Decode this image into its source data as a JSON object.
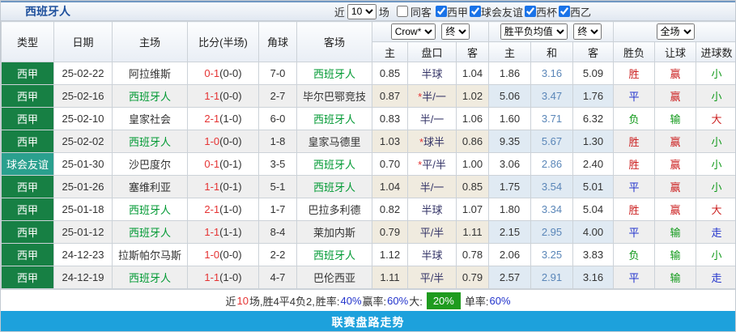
{
  "title": "西班牙人",
  "toolbar": {
    "recent_label": "近",
    "recent_value": "10",
    "games_label": "场",
    "same_away_label": "同客",
    "same_away_checked": false,
    "league_filters": [
      {
        "label": "西甲",
        "checked": true
      },
      {
        "label": "球会友谊",
        "checked": true
      },
      {
        "label": "西杯",
        "checked": true
      },
      {
        "label": "西乙",
        "checked": true
      }
    ]
  },
  "header": {
    "static_cols": [
      "类型",
      "日期",
      "主场",
      "比分(半场)",
      "角球",
      "客场"
    ],
    "groups": [
      {
        "select": "Crow*",
        "extra_select": "终",
        "cols": [
          "主",
          "盘口",
          "客"
        ]
      },
      {
        "select": "胜平负均值",
        "extra_select": "终",
        "cols": [
          "主",
          "和",
          "客"
        ]
      },
      {
        "select": "全场",
        "extra_select": "",
        "cols": [
          "胜负",
          "让球",
          "进球数"
        ]
      }
    ]
  },
  "rows": [
    {
      "type": "西甲",
      "type_class": "league",
      "date": "25-02-22",
      "home": "阿拉维斯",
      "home_self": false,
      "score": "0-1",
      "half": "(0-0)",
      "corner": "7-0",
      "away": "西班牙人",
      "away_self": true,
      "odds_home": "0.85",
      "handicap": "半球",
      "handicap_star": false,
      "odds_away": "1.04",
      "avg_home": "1.86",
      "avg_draw": "3.16",
      "avg_away": "5.09",
      "result": "胜",
      "result_class": "red",
      "handicap_result": "赢",
      "handicap_class": "red",
      "goals": "小",
      "goals_class": "green"
    },
    {
      "type": "西甲",
      "type_class": "league",
      "date": "25-02-16",
      "home": "西班牙人",
      "home_self": true,
      "score": "1-1",
      "half": "(0-0)",
      "corner": "2-7",
      "away": "毕尔巴鄂竞技",
      "away_self": false,
      "odds_home": "0.87",
      "handicap": "半/一",
      "handicap_star": true,
      "odds_away": "1.02",
      "avg_home": "5.06",
      "avg_draw": "3.47",
      "avg_away": "1.76",
      "result": "平",
      "result_class": "blue",
      "handicap_result": "赢",
      "handicap_class": "red",
      "goals": "小",
      "goals_class": "green"
    },
    {
      "type": "西甲",
      "type_class": "league",
      "date": "25-02-10",
      "home": "皇家社会",
      "home_self": false,
      "score": "2-1",
      "half": "(1-0)",
      "corner": "6-0",
      "away": "西班牙人",
      "away_self": true,
      "odds_home": "0.83",
      "handicap": "半/一",
      "handicap_star": false,
      "odds_away": "1.06",
      "avg_home": "1.60",
      "avg_draw": "3.71",
      "avg_away": "6.32",
      "result": "负",
      "result_class": "green",
      "handicap_result": "输",
      "handicap_class": "green",
      "goals": "大",
      "goals_class": "red"
    },
    {
      "type": "西甲",
      "type_class": "league",
      "date": "25-02-02",
      "home": "西班牙人",
      "home_self": true,
      "score": "1-0",
      "half": "(0-0)",
      "corner": "1-8",
      "away": "皇家马德里",
      "away_self": false,
      "odds_home": "1.03",
      "handicap": "球半",
      "handicap_star": true,
      "odds_away": "0.86",
      "avg_home": "9.35",
      "avg_draw": "5.67",
      "avg_away": "1.30",
      "result": "胜",
      "result_class": "red",
      "handicap_result": "赢",
      "handicap_class": "red",
      "goals": "小",
      "goals_class": "green"
    },
    {
      "type": "球会友谊",
      "type_class": "friendly",
      "date": "25-01-30",
      "home": "沙巴度尔",
      "home_self": false,
      "score": "0-1",
      "half": "(0-1)",
      "corner": "3-5",
      "away": "西班牙人",
      "away_self": true,
      "odds_home": "0.70",
      "handicap": "平/半",
      "handicap_star": true,
      "odds_away": "1.00",
      "avg_home": "3.06",
      "avg_draw": "2.86",
      "avg_away": "2.40",
      "result": "胜",
      "result_class": "red",
      "handicap_result": "赢",
      "handicap_class": "red",
      "goals": "小",
      "goals_class": "green"
    },
    {
      "type": "西甲",
      "type_class": "league",
      "date": "25-01-26",
      "home": "塞维利亚",
      "home_self": false,
      "score": "1-1",
      "half": "(0-1)",
      "corner": "5-1",
      "away": "西班牙人",
      "away_self": true,
      "odds_home": "1.04",
      "handicap": "半/一",
      "handicap_star": false,
      "odds_away": "0.85",
      "avg_home": "1.75",
      "avg_draw": "3.54",
      "avg_away": "5.01",
      "result": "平",
      "result_class": "blue",
      "handicap_result": "赢",
      "handicap_class": "red",
      "goals": "小",
      "goals_class": "green"
    },
    {
      "type": "西甲",
      "type_class": "league",
      "date": "25-01-18",
      "home": "西班牙人",
      "home_self": true,
      "score": "2-1",
      "half": "(1-0)",
      "corner": "1-7",
      "away": "巴拉多利德",
      "away_self": false,
      "odds_home": "0.82",
      "handicap": "半球",
      "handicap_star": false,
      "odds_away": "1.07",
      "avg_home": "1.80",
      "avg_draw": "3.34",
      "avg_away": "5.04",
      "result": "胜",
      "result_class": "red",
      "handicap_result": "赢",
      "handicap_class": "red",
      "goals": "大",
      "goals_class": "red"
    },
    {
      "type": "西甲",
      "type_class": "league",
      "date": "25-01-12",
      "home": "西班牙人",
      "home_self": true,
      "score": "1-1",
      "half": "(1-1)",
      "corner": "8-4",
      "away": "莱加内斯",
      "away_self": false,
      "odds_home": "0.79",
      "handicap": "平/半",
      "handicap_star": false,
      "odds_away": "1.11",
      "avg_home": "2.15",
      "avg_draw": "2.95",
      "avg_away": "4.00",
      "result": "平",
      "result_class": "blue",
      "handicap_result": "输",
      "handicap_class": "green",
      "goals": "走",
      "goals_class": "blue"
    },
    {
      "type": "西甲",
      "type_class": "league",
      "date": "24-12-23",
      "home": "拉斯帕尔马斯",
      "home_self": false,
      "score": "1-0",
      "half": "(0-0)",
      "corner": "2-2",
      "away": "西班牙人",
      "away_self": true,
      "odds_home": "1.12",
      "handicap": "半球",
      "handicap_star": false,
      "odds_away": "0.78",
      "avg_home": "2.06",
      "avg_draw": "3.25",
      "avg_away": "3.83",
      "result": "负",
      "result_class": "green",
      "handicap_result": "输",
      "handicap_class": "green",
      "goals": "小",
      "goals_class": "green"
    },
    {
      "type": "西甲",
      "type_class": "league",
      "date": "24-12-19",
      "home": "西班牙人",
      "home_self": true,
      "score": "1-1",
      "half": "(1-0)",
      "corner": "4-7",
      "away": "巴伦西亚",
      "away_self": false,
      "odds_home": "1.11",
      "handicap": "平/半",
      "handicap_star": false,
      "odds_away": "0.79",
      "avg_home": "2.57",
      "avg_draw": "2.91",
      "avg_away": "3.16",
      "result": "平",
      "result_class": "blue",
      "handicap_result": "输",
      "handicap_class": "green",
      "goals": "走",
      "goals_class": "blue"
    }
  ],
  "summary": {
    "recent_label": "近",
    "recent_count": "10",
    "record_text": "场,胜4平4负2,",
    "win_rate_label": " 胜率:",
    "win_rate": "40%",
    "handicap_label": " 赢率:",
    "handicap_rate": "60%",
    "big_label": " 大:",
    "big_rate": "20%",
    "single_label": " 单率:",
    "single_rate": "60%"
  },
  "footer_bar": "联赛盘路走势",
  "colors": {
    "league_green": "#178044",
    "friendly_teal": "#2aa08e",
    "self_team_green": "#009933",
    "score_red": "#e53333",
    "big_rate_badge_green": "#1f9b1f",
    "bottom_bar_blue": "#1da1dc",
    "title_blue": "#1d4f9c"
  }
}
